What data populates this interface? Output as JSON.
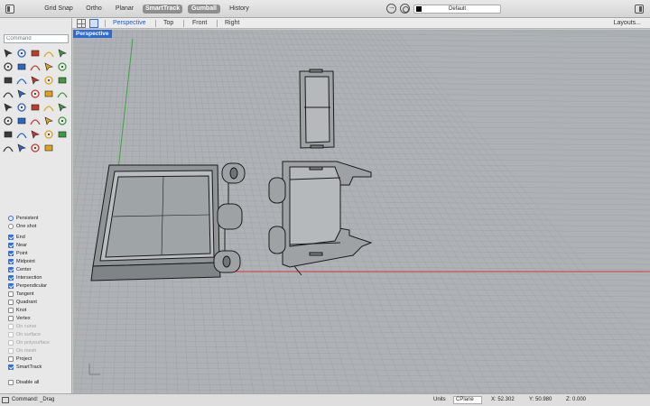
{
  "toolbar": {
    "modes": [
      {
        "label": "Grid Snap",
        "on": false
      },
      {
        "label": "Ortho",
        "on": false
      },
      {
        "label": "Planar",
        "on": false
      },
      {
        "label": "SmartTrack",
        "on": true
      },
      {
        "label": "Gumball",
        "on": true
      },
      {
        "label": "History",
        "on": false
      }
    ],
    "layer": {
      "name": "Default",
      "color": "#000000"
    }
  },
  "viewport_tabs": {
    "tabs": [
      "Perspective",
      "Top",
      "Front",
      "Right"
    ],
    "active": "Perspective",
    "layouts_label": "Layouts..."
  },
  "viewport": {
    "label": "Perspective",
    "label_color": "#2e6ad7"
  },
  "command": {
    "placeholder": "Command"
  },
  "tool_icons": [
    "select-arrow-icon",
    "point-icon",
    "polyline-icon",
    "curve-icon",
    "circle-icon",
    "ellipse-icon",
    "rectangle-icon",
    "arc-icon",
    "freeform-icon",
    "polygon-icon",
    "fillet-icon",
    "offset-icon",
    "surface-icon",
    "loft-icon",
    "solid-box-icon",
    "extrude-icon",
    "mesh-icon",
    "trim-icon",
    "split-icon",
    "boolean-icon",
    "move-icon",
    "rotate-icon",
    "scale-icon",
    "array-icon",
    "grid-icon",
    "text-icon",
    "dimension-icon",
    "zoom-icon",
    "render-icon",
    "light-icon",
    "material-icon",
    "analyze-icon",
    "sphere-icon",
    "gumball-icon",
    "color-wheel-icon",
    "bulb-icon",
    "globe-icon",
    "pen-icon",
    "transform-icon"
  ],
  "osnap": {
    "mode": [
      {
        "label": "Persistent",
        "selected": true
      },
      {
        "label": "One shot",
        "selected": false
      }
    ],
    "items": [
      {
        "label": "End",
        "checked": true,
        "enabled": true
      },
      {
        "label": "Near",
        "checked": true,
        "enabled": true
      },
      {
        "label": "Point",
        "checked": true,
        "enabled": true
      },
      {
        "label": "Midpoint",
        "checked": true,
        "enabled": true
      },
      {
        "label": "Center",
        "checked": true,
        "enabled": true
      },
      {
        "label": "Intersection",
        "checked": true,
        "enabled": true
      },
      {
        "label": "Perpendicular",
        "checked": true,
        "enabled": true
      },
      {
        "label": "Tangent",
        "checked": false,
        "enabled": true
      },
      {
        "label": "Quadrant",
        "checked": false,
        "enabled": true
      },
      {
        "label": "Knot",
        "checked": false,
        "enabled": true
      },
      {
        "label": "Vertex",
        "checked": false,
        "enabled": true
      },
      {
        "label": "On curve",
        "checked": false,
        "enabled": false
      },
      {
        "label": "On surface",
        "checked": false,
        "enabled": false
      },
      {
        "label": "On polysurface",
        "checked": false,
        "enabled": false
      },
      {
        "label": "On mesh",
        "checked": false,
        "enabled": false
      },
      {
        "label": "Project",
        "checked": false,
        "enabled": true
      },
      {
        "label": "SmartTrack",
        "checked": true,
        "enabled": true
      }
    ],
    "disable_all": "Disable all"
  },
  "status": {
    "command": "Command: _Drag",
    "units_label": "Units",
    "cplane": "CPlane",
    "x": "X: 52.302",
    "y": "Y: 50.980",
    "z": "Z: 0.000"
  }
}
